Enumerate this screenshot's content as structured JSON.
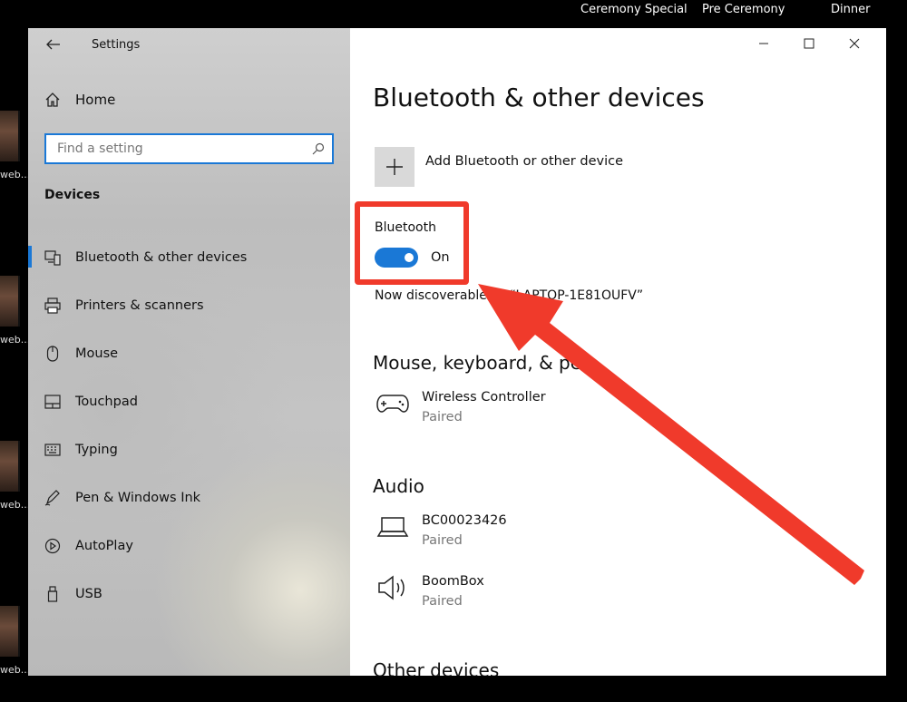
{
  "desktop": {
    "top_items": [
      "Ceremony Special",
      "Pre Ceremony",
      "Dinner"
    ],
    "side_label": "web..."
  },
  "window": {
    "app_title": "Settings",
    "nav": {
      "home_label": "Home",
      "search_placeholder": "Find a setting",
      "section": "Devices",
      "items": [
        {
          "label": "Bluetooth & other devices",
          "icon": "bluetooth-devices-icon",
          "active": true
        },
        {
          "label": "Printers & scanners",
          "icon": "printer-icon"
        },
        {
          "label": "Mouse",
          "icon": "mouse-icon"
        },
        {
          "label": "Touchpad",
          "icon": "touchpad-icon"
        },
        {
          "label": "Typing",
          "icon": "keyboard-icon"
        },
        {
          "label": "Pen & Windows Ink",
          "icon": "pen-icon"
        },
        {
          "label": "AutoPlay",
          "icon": "autoplay-icon"
        },
        {
          "label": "USB",
          "icon": "usb-icon"
        }
      ]
    },
    "content": {
      "title": "Bluetooth & other devices",
      "add_device_label": "Add Bluetooth or other device",
      "bluetooth_label": "Bluetooth",
      "toggle_state": "On",
      "discoverable_text": "Now discoverable as “LAPTOP-1E81OUFV”",
      "sections": {
        "input": "Mouse, keyboard, & pen",
        "audio": "Audio",
        "other": "Other devices"
      },
      "devices": {
        "controller": {
          "name": "Wireless Controller",
          "status": "Paired"
        },
        "laptop": {
          "name": "BC00023426",
          "status": "Paired"
        },
        "speaker": {
          "name": "BoomBox",
          "status": "Paired"
        }
      }
    }
  },
  "annotation": {
    "color": "#f03a2b"
  },
  "colors": {
    "accent": "#1a78d6"
  }
}
